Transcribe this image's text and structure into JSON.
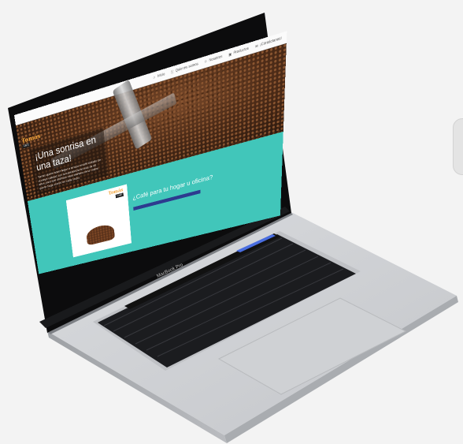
{
  "laptop": {
    "model_label": "MacBook Pro"
  },
  "site": {
    "logo": {
      "name": "Tomás",
      "tagline": "CAFÉ"
    },
    "nav": [
      {
        "label": "Inicio",
        "icon": "home-icon"
      },
      {
        "label": "Quienes somos",
        "icon": "info-icon"
      },
      {
        "label": "Nosotros",
        "icon": "users-icon"
      },
      {
        "label": "Productos",
        "icon": "box-icon"
      },
      {
        "label": "¡Contáctanos!",
        "icon": "mail-icon"
      }
    ],
    "hero": {
      "title": "¡Una sonrisa en una taza!",
      "text": "Tomás quiere hacer llegar a tu taza el café tostado de la mejor calidad, con la experiencia de más de 40 años, para que disfrutes cada mañana de un sabor que te haga sonreír en cada sorbo."
    },
    "section": {
      "heading": "¿Café para tu hogar u oficina?"
    }
  },
  "colors": {
    "accent": "#41c6ba",
    "logo": "#f2a43a",
    "cta": "#2d3b8f"
  }
}
